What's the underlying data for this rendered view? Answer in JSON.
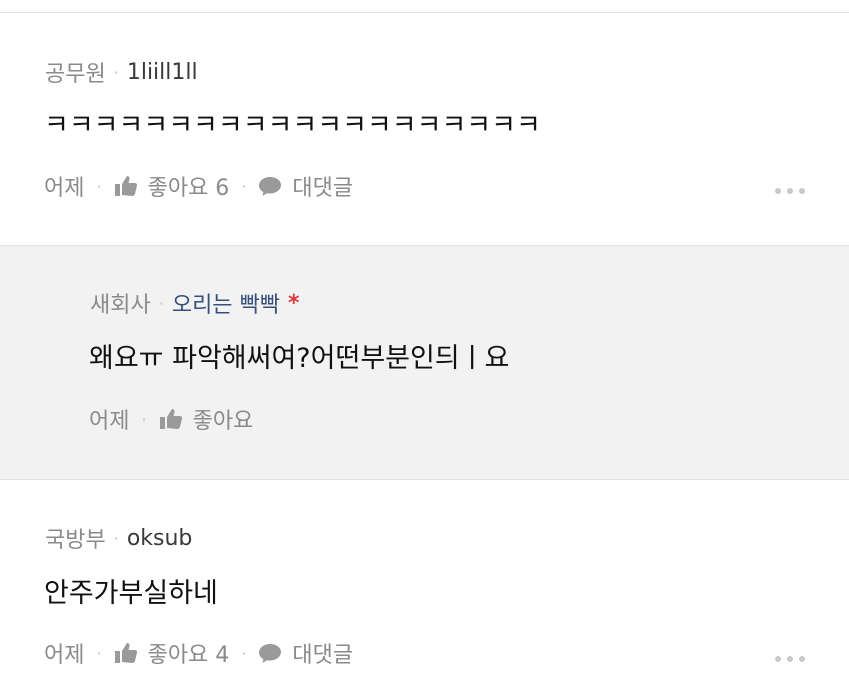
{
  "comments": [
    {
      "company": "공무원",
      "nickname": "1liill1ll",
      "text": "ㅋㅋㅋㅋㅋㅋㅋㅋㅋㅋㅋㅋㅋㅋㅋㅋㅋㅋㅋㅋ",
      "time": "어제",
      "like_label": "좋아요 6",
      "reply_label": "대댓글"
    },
    {
      "company": "새회사",
      "nickname": "오리는 빡빡",
      "author_marker": "*",
      "text": "왜요ㅠ 파악해써여?어떤부분인듸ㅣ요",
      "time": "어제",
      "like_label": "좋아요"
    },
    {
      "company": "국방부",
      "nickname": "oksub",
      "text": "안주가부실하네",
      "time": "어제",
      "like_label": "좋아요 4",
      "reply_label": "대댓글"
    }
  ],
  "separator_glyph": "·",
  "colors": {
    "reply_background": "#f2f2f2",
    "nickname_reply": "#36507a",
    "author_marker": "#d83a3a"
  }
}
